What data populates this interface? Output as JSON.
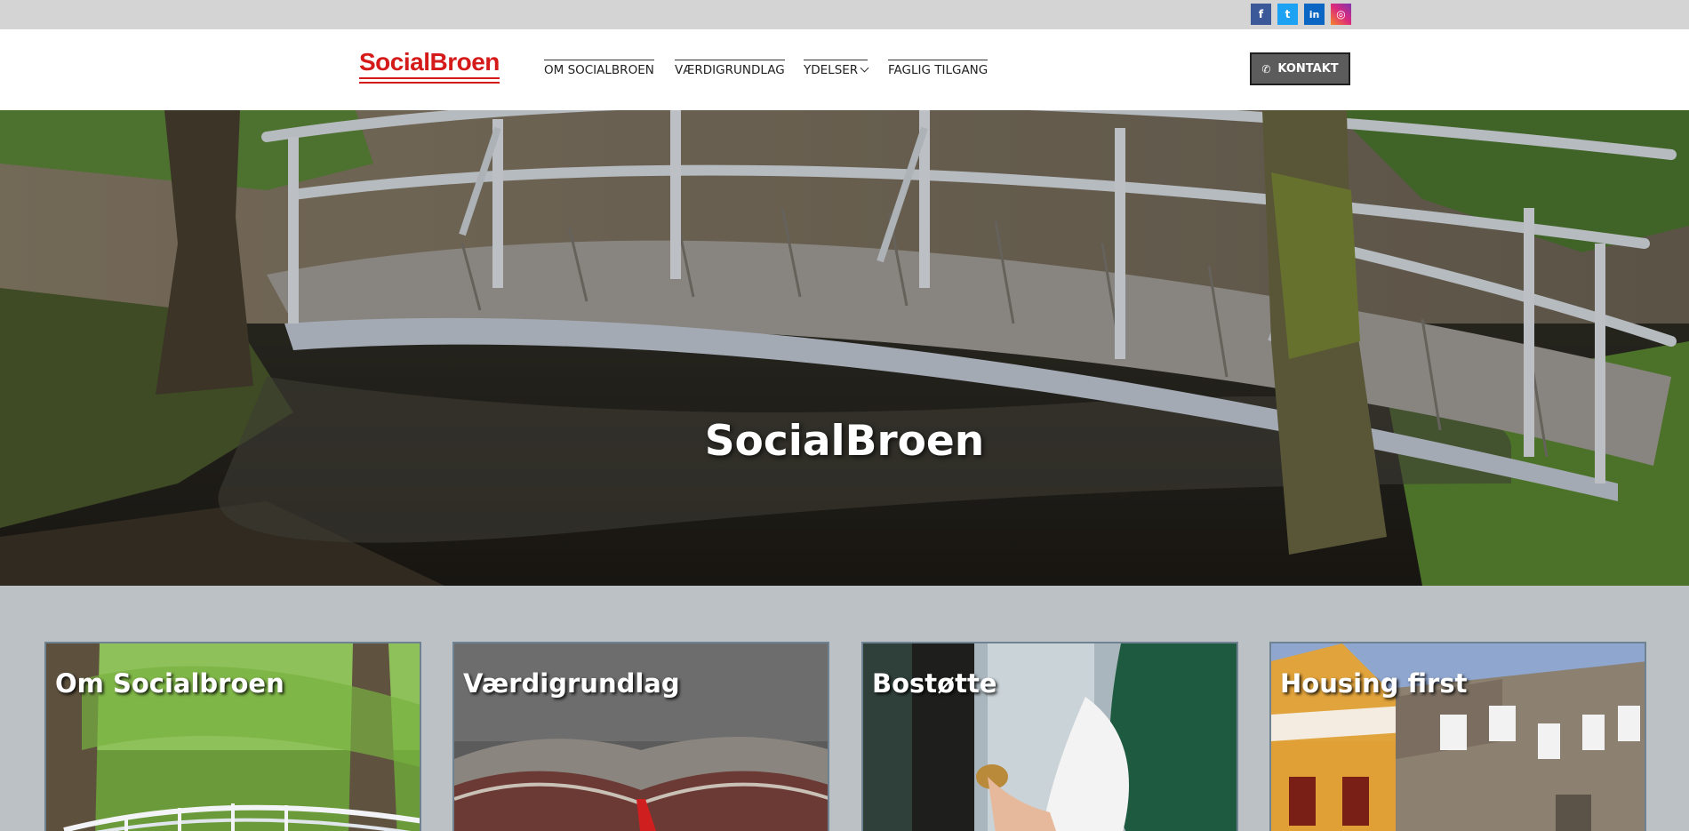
{
  "social": {
    "facebook": "f",
    "twitter": "t",
    "linkedin": "in",
    "instagram": "◎"
  },
  "header": {
    "logo_text": "SocialBroen",
    "nav": [
      {
        "label": "OM SOCIALBROEN"
      },
      {
        "label": "VÆRDIGRUNDLAG"
      },
      {
        "label": "YDELSER"
      },
      {
        "label": "FAGLIG TILGANG"
      }
    ],
    "contact_label": "KONTAKT",
    "contact_icon": "phone-icon"
  },
  "hero": {
    "title": "SocialBroen"
  },
  "cards": [
    {
      "title": "Om Socialbroen"
    },
    {
      "title": "Værdigrundlag"
    },
    {
      "title": "Bostøtte"
    },
    {
      "title": "Housing first"
    }
  ],
  "colors": {
    "brand_red": "#d51a1a",
    "topbar": "#d4d4d4",
    "page_bg": "#bcc1c5",
    "contact_button": "#5c5c5c"
  }
}
